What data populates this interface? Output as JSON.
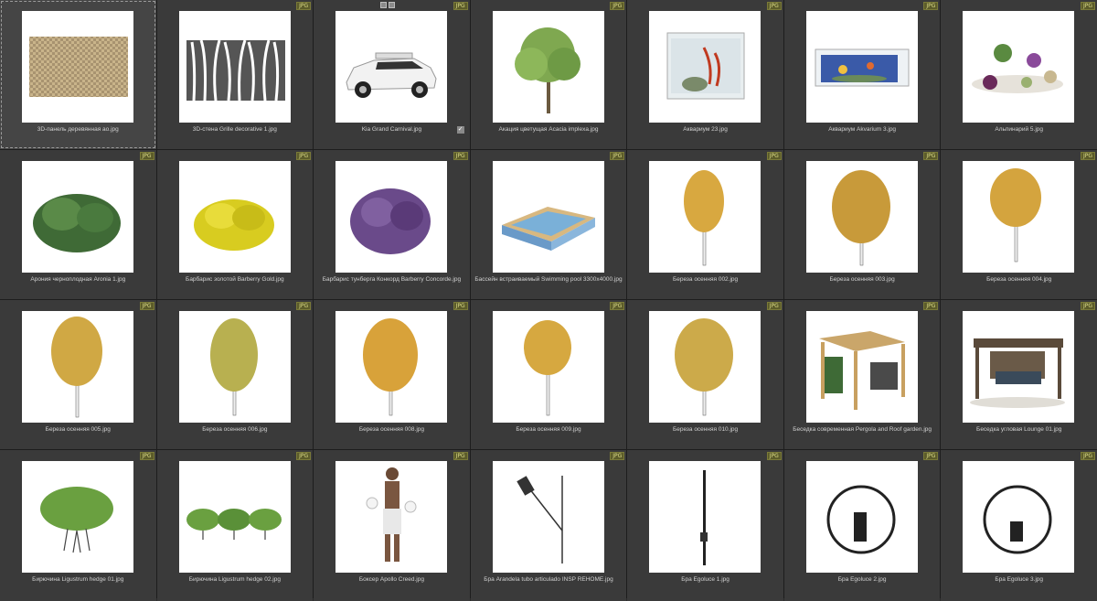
{
  "badge_text": "JPG",
  "items": [
    {
      "label": "3D-панель деревянная ao.jpg",
      "badge": true,
      "icon": "wood-panel-thumbnail"
    },
    {
      "label": "3D-стена Grille decorative 1.jpg",
      "badge": true,
      "icon": "grille-thumbnail"
    },
    {
      "label": "Kia Grand Carnival.jpg",
      "badge": true,
      "icon": "car-thumbnail"
    },
    {
      "label": "Акация цветущая Acacia implexa.jpg",
      "badge": true,
      "icon": "tree-thumbnail"
    },
    {
      "label": "Аквариум 23.jpg",
      "badge": true,
      "icon": "aquarium-thumbnail"
    },
    {
      "label": "Аквариум Akvarium 3.jpg",
      "badge": true,
      "icon": "aquarium-thumbnail"
    },
    {
      "label": "Альпинарий 5.jpg",
      "badge": true,
      "icon": "rock-garden-thumbnail"
    },
    {
      "label": "Арония черноплодная Aronia 1.jpg",
      "badge": true,
      "icon": "shrub-thumbnail"
    },
    {
      "label": "Барбарис золотой Barberry Gold.jpg",
      "badge": true,
      "icon": "shrub-thumbnail"
    },
    {
      "label": "Барбарис тунберга Конкорд Barberry Concorde.jpg",
      "badge": true,
      "icon": "shrub-thumbnail"
    },
    {
      "label": "Бассейн встраиваемый Swimming pool 3300x4000.jpg",
      "badge": true,
      "icon": "pool-thumbnail"
    },
    {
      "label": "Береза осенняя 002.jpg",
      "badge": true,
      "icon": "birch-thumbnail"
    },
    {
      "label": "Береза осенняя 003.jpg",
      "badge": true,
      "icon": "birch-thumbnail"
    },
    {
      "label": "Береза осенняя 004.jpg",
      "badge": true,
      "icon": "birch-thumbnail"
    },
    {
      "label": "Береза осенняя 005.jpg",
      "badge": true,
      "icon": "birch-thumbnail"
    },
    {
      "label": "Береза осенняя 006.jpg",
      "badge": true,
      "icon": "birch-thumbnail"
    },
    {
      "label": "Береза осенняя 008.jpg",
      "badge": true,
      "icon": "birch-thumbnail"
    },
    {
      "label": "Береза осенняя 009.jpg",
      "badge": true,
      "icon": "birch-thumbnail"
    },
    {
      "label": "Береза осенняя 010.jpg",
      "badge": true,
      "icon": "birch-thumbnail"
    },
    {
      "label": "Беседка современная Pergola and Roof garden.jpg",
      "badge": true,
      "icon": "pergola-thumbnail"
    },
    {
      "label": "Беседка угловая Lounge 01.jpg",
      "badge": true,
      "icon": "pergola-thumbnail"
    },
    {
      "label": "Бирючина Ligustrum hedge 01.jpg",
      "badge": true,
      "icon": "hedge-thumbnail"
    },
    {
      "label": "Бирючина Ligustrum hedge 02.jpg",
      "badge": true,
      "icon": "hedge-thumbnail"
    },
    {
      "label": "Боксер Apollo Creed.jpg",
      "badge": true,
      "icon": "boxer-thumbnail"
    },
    {
      "label": "Бра Arandela tubo articulado INSP REHOME.jpg",
      "badge": true,
      "icon": "wall-lamp-thumbnail"
    },
    {
      "label": "Бра Egoluce 1.jpg",
      "badge": true,
      "icon": "wall-lamp-thumbnail"
    },
    {
      "label": "Бра Egoluce 2.jpg",
      "badge": true,
      "icon": "ring-lamp-thumbnail"
    },
    {
      "label": "Бра Egoluce 3.jpg",
      "badge": true,
      "icon": "ring-lamp-thumbnail"
    }
  ]
}
